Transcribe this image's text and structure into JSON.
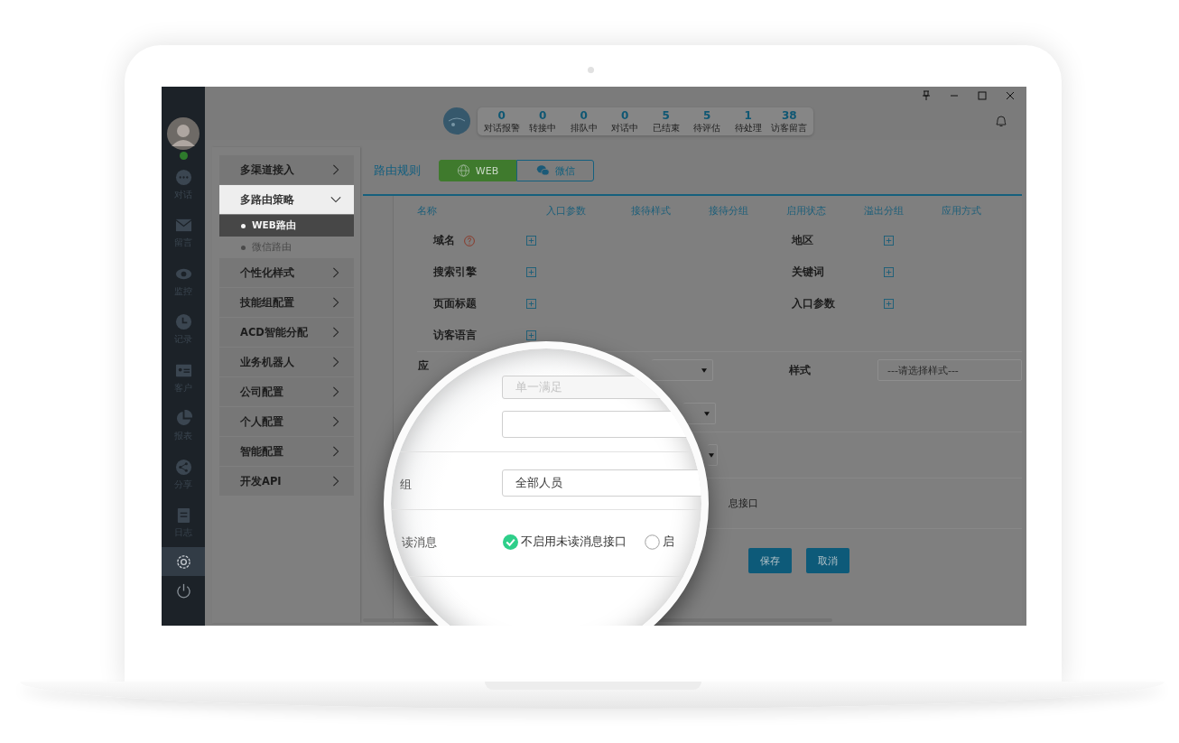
{
  "profile": {
    "online": true
  },
  "rail": [
    {
      "kind": "chat",
      "label": "对话",
      "selected": false
    },
    {
      "kind": "mail",
      "label": "留言",
      "selected": false
    },
    {
      "kind": "eye",
      "label": "监控",
      "selected": false
    },
    {
      "kind": "clock",
      "label": "记录",
      "selected": false
    },
    {
      "kind": "card",
      "label": "客户",
      "selected": false
    },
    {
      "kind": "pie",
      "label": "报表",
      "selected": false
    },
    {
      "kind": "share",
      "label": "分享",
      "selected": false
    },
    {
      "kind": "clipboard",
      "label": "日志",
      "selected": false
    },
    {
      "kind": "settings",
      "selected": true
    },
    {
      "kind": "power",
      "selected": false
    }
  ],
  "stats": [
    {
      "value": "0",
      "label": "对话报警"
    },
    {
      "value": "0",
      "label": "转接中"
    },
    {
      "value": "0",
      "label": "排队中"
    },
    {
      "value": "0",
      "label": "对话中"
    },
    {
      "value": "5",
      "label": "已结束"
    },
    {
      "value": "5",
      "label": "待评估"
    },
    {
      "value": "1",
      "label": "待处理"
    },
    {
      "value": "38",
      "label": "访客留言"
    }
  ],
  "menu": [
    {
      "label": "多渠道接入",
      "expanded": false,
      "selected": false
    },
    {
      "label": "多路由策略",
      "expanded": true,
      "selected": true,
      "children": [
        {
          "label": "WEB路由",
          "selected": true
        },
        {
          "label": "微信路由",
          "selected": false
        }
      ]
    },
    {
      "label": "个性化样式",
      "expanded": false,
      "selected": false
    },
    {
      "label": "技能组配置",
      "expanded": false,
      "selected": false
    },
    {
      "label": "ACD智能分配",
      "expanded": false,
      "selected": false
    },
    {
      "label": "业务机器人",
      "expanded": false,
      "selected": false
    },
    {
      "label": "公司配置",
      "expanded": false,
      "selected": false
    },
    {
      "label": "个人配置",
      "expanded": false,
      "selected": false
    },
    {
      "label": "智能配置",
      "expanded": false,
      "selected": false
    },
    {
      "label": "开发API",
      "expanded": false,
      "selected": false
    }
  ],
  "page": {
    "title": "路由规则",
    "tabs": [
      {
        "kind": "web",
        "label": "WEB",
        "selected": true
      },
      {
        "kind": "wechat",
        "label": "微信",
        "selected": false
      }
    ]
  },
  "columns": [
    "名称",
    "入口参数",
    "接待样式",
    "接待分组",
    "启用状态",
    "溢出分组",
    "应用方式"
  ],
  "conditions": [
    {
      "left": "域名",
      "help": true,
      "right": "地区"
    },
    {
      "left": "搜索引擎",
      "help": false,
      "right": "关键词"
    },
    {
      "left": "页面标题",
      "help": false,
      "right": "入口参数"
    },
    {
      "left": "访客语言",
      "help": false
    }
  ],
  "form": {
    "row_1_label": "应",
    "style_label": "样式",
    "style_placeholder": "---请选择样式---",
    "row_4_text": "息接口"
  },
  "buttons": [
    "保存",
    "取消"
  ],
  "magnifier": {
    "select_value": "单一满足",
    "group_label": "组",
    "group_value": "全部人员",
    "unread_label": "读消息",
    "options": [
      {
        "label": "不启用未读消息接口",
        "selected": true
      },
      {
        "label": "启",
        "selected": false
      }
    ]
  }
}
